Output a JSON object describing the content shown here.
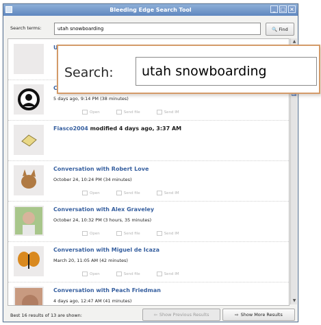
{
  "window": {
    "title": "Bleeding Edge Search Tool",
    "controls": [
      "_",
      "□",
      "×"
    ]
  },
  "search": {
    "label": "Search terms:",
    "value": "utah snowboarding",
    "find_label": "Find"
  },
  "overlay": {
    "label": "Search:",
    "value": "utah snowboarding"
  },
  "results": [
    {
      "title_prefix": "U",
      "title_main": "",
      "subtitle": "",
      "actions": []
    },
    {
      "title_prefix": "C",
      "title_main": "",
      "subtitle": "5 days ago, 9:14 PM (38 minutes)",
      "actions": [
        "Open",
        "Send file",
        "Send IM"
      ]
    },
    {
      "title_prefix": "Fiasco2004",
      "title_main": " modified 4 days ago, 3:37 AM",
      "subtitle": "",
      "actions": []
    },
    {
      "title_prefix": "Conversation with Robert Love",
      "title_main": "",
      "subtitle": "October 24, 10:24 PM (34 minutes)",
      "actions": [
        "Open",
        "Send file",
        "Send IM"
      ]
    },
    {
      "title_prefix": "Conversation with Alex Graveley",
      "title_main": "",
      "subtitle": "October 24, 10:32 PM (3 hours, 35 minutes)",
      "actions": [
        "Open",
        "Send file",
        "Send IM"
      ]
    },
    {
      "title_prefix": "Conversation with Miguel de Icaza",
      "title_main": "",
      "subtitle": "March 20, 11:05 AM (42 minutes)",
      "actions": [
        "Open",
        "Send file",
        "Send IM"
      ]
    },
    {
      "title_prefix": "Conversation with Peach Friedman",
      "title_main": "",
      "subtitle": "4 days ago, 12:47 AM (41 minutes)",
      "actions": []
    }
  ],
  "footer": {
    "summary": "Best 16 results of 13 are shown:",
    "prev_label": "Show Previous Results",
    "more_label": "Show More Results"
  },
  "icons": [
    "app-icon",
    "find-icon",
    "thumb-icons",
    "prev-arrow-icon",
    "next-arrow-icon"
  ]
}
